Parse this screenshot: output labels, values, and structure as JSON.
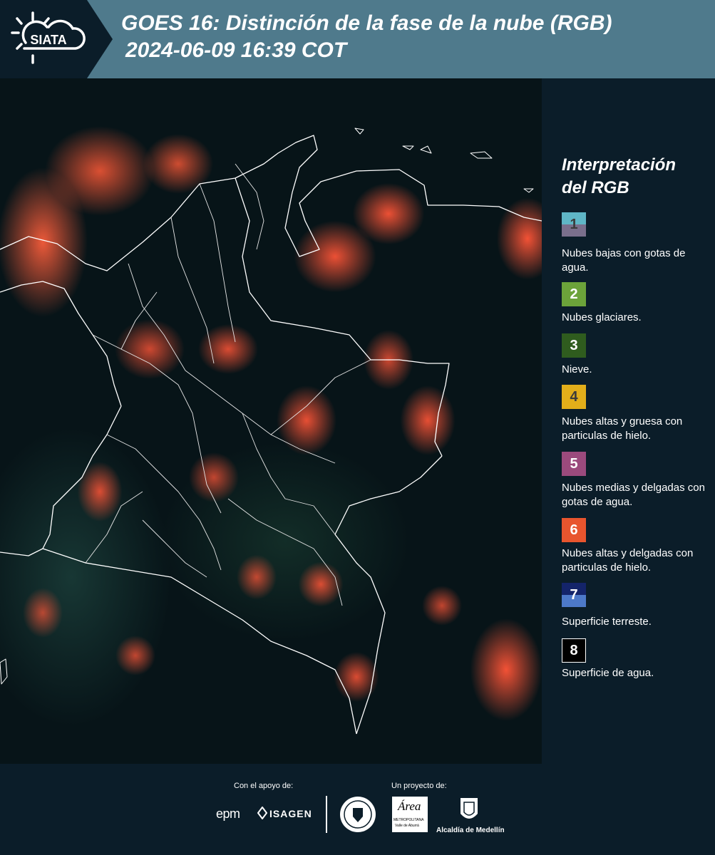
{
  "header": {
    "logo_text": "SIATA",
    "title_line1": "GOES 16: Distinción de la fase de la nube (RGB)",
    "title_line2": "2024-06-09 16:39 COT"
  },
  "legend": {
    "title": "Interpretación del RGB",
    "items": [
      {
        "number": "1",
        "label": "Nubes bajas con gotas de agua.",
        "color_top": "#5fb6c6",
        "color_bottom": "#7a6f8c"
      },
      {
        "number": "2",
        "label": "Nubes glaciares.",
        "color": "#6ca33a"
      },
      {
        "number": "3",
        "label": "Nieve.",
        "color": "#2f5c1e"
      },
      {
        "number": "4",
        "label": "Nubes altas y gruesa con particulas de hielo.",
        "color": "#e2ae1a"
      },
      {
        "number": "5",
        "label": "Nubes medias y delgadas con gotas de agua.",
        "color": "#9b4a7d"
      },
      {
        "number": "6",
        "label": "Nubes altas y delgadas con particulas de hielo.",
        "color": "#e8552e"
      },
      {
        "number": "7",
        "label": "Superficie terreste.",
        "color_top": "#14246a",
        "color_bottom": "#4d79c9"
      },
      {
        "number": "8",
        "label": "Superficie de agua.",
        "color": "#000000"
      }
    ]
  },
  "footer": {
    "support_label": "Con el apoyo de:",
    "project_label": "Un proyecto de:",
    "sponsor_epm": "epm",
    "sponsor_isagen": "ISAGEN",
    "area_metro_text": "Área",
    "area_metro_sub1": "METROPOLITANA",
    "area_metro_sub2": "Valle de Aburrá",
    "alcaldia_text": "Alcaldía de Medellín"
  }
}
